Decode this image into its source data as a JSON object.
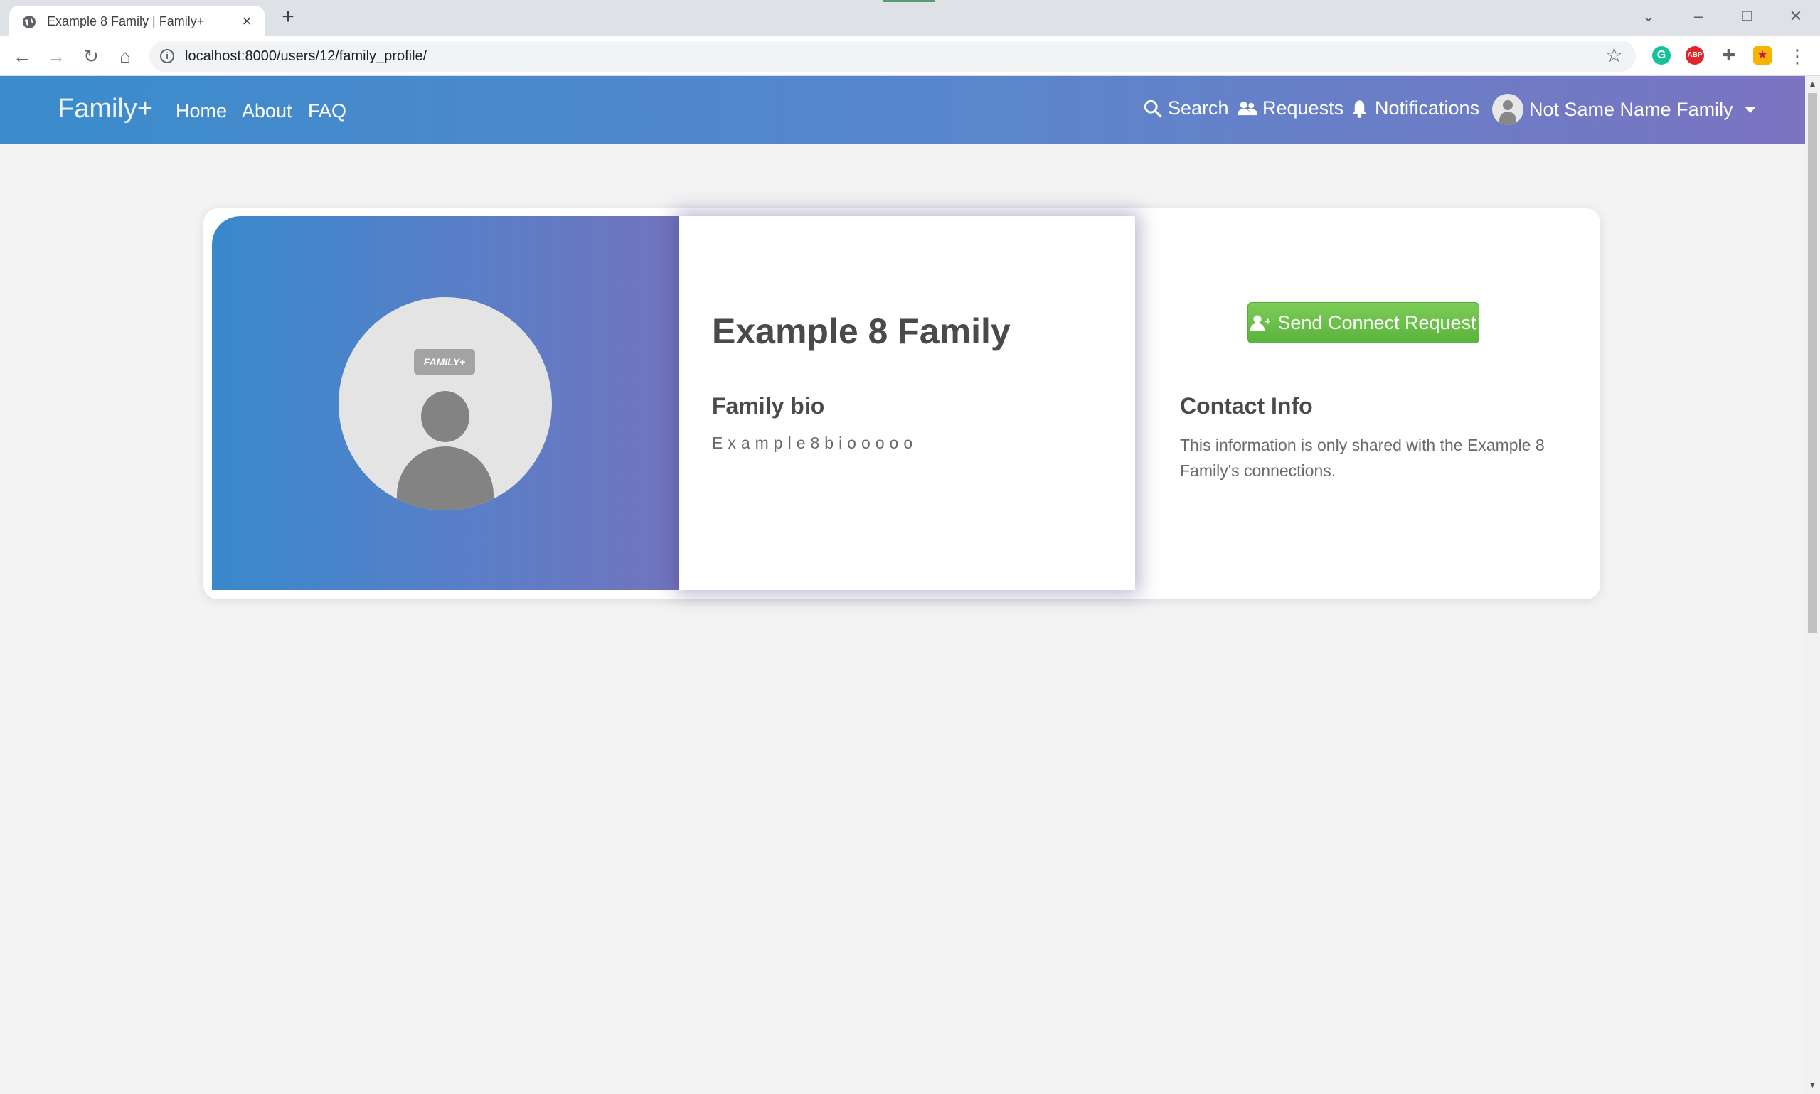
{
  "browser": {
    "tab_title": "Example 8 Family | Family+",
    "url": "localhost:8000/users/12/family_profile/",
    "extensions": [
      "grammarly-icon",
      "adblock-icon",
      "puzzle-icon",
      "profile-extension-icon"
    ]
  },
  "navbar": {
    "brand": "Family+",
    "links": [
      "Home",
      "About",
      "FAQ"
    ],
    "search_label": "Search",
    "requests_label": "Requests",
    "notifications_label": "Notifications",
    "user_label": "Not Same Name Family"
  },
  "profile": {
    "avatar_logo": "FAMILY+",
    "family_name": "Example 8 Family",
    "bio_heading": "Family bio",
    "bio_text": "Example8biooooo",
    "connect_button_label": "Send Connect Request",
    "contact_heading": "Contact Info",
    "contact_text": "This information is only shared with the Example 8 Family's connections."
  },
  "colors": {
    "navbar_gradient_start": "#3a8ccc",
    "navbar_gradient_end": "#7b74c1",
    "connect_button": "#6cc24a",
    "page_background": "#f3f3f3"
  }
}
